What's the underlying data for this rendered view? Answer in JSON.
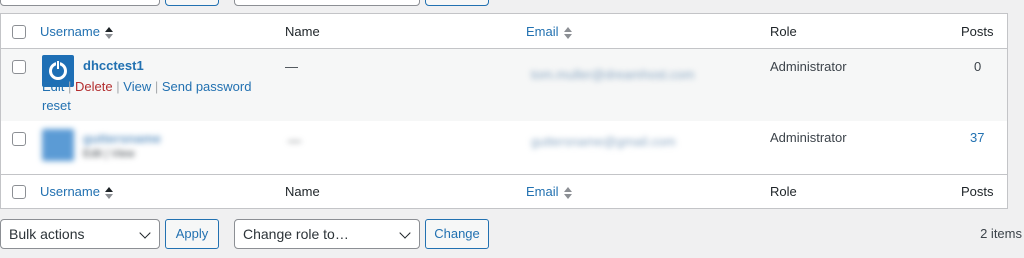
{
  "table": {
    "header": {
      "username": "Username",
      "name": "Name",
      "email": "Email",
      "role": "Role",
      "posts": "Posts"
    },
    "rows": [
      {
        "username": "dhcctest1",
        "actions": {
          "edit": "Edit",
          "delete": "Delete",
          "view": "View",
          "send_reset": "Send password reset"
        },
        "name": "—",
        "email": "tom.muller@dreamhost.com",
        "role": "Administrator",
        "posts": "0"
      },
      {
        "username": "guttersname",
        "actions_text": "Edit | View",
        "name": "—",
        "email": "guttersname@gmail.com",
        "role": "Administrator",
        "posts": "37"
      }
    ]
  },
  "bottom": {
    "bulk_actions": "Bulk actions",
    "apply": "Apply",
    "change_role": "Change role to…",
    "change": "Change",
    "count": "2 items"
  },
  "colors": {
    "link": "#2271b1",
    "delete": "#b32d2e",
    "avatar": "#1e6fb5"
  }
}
